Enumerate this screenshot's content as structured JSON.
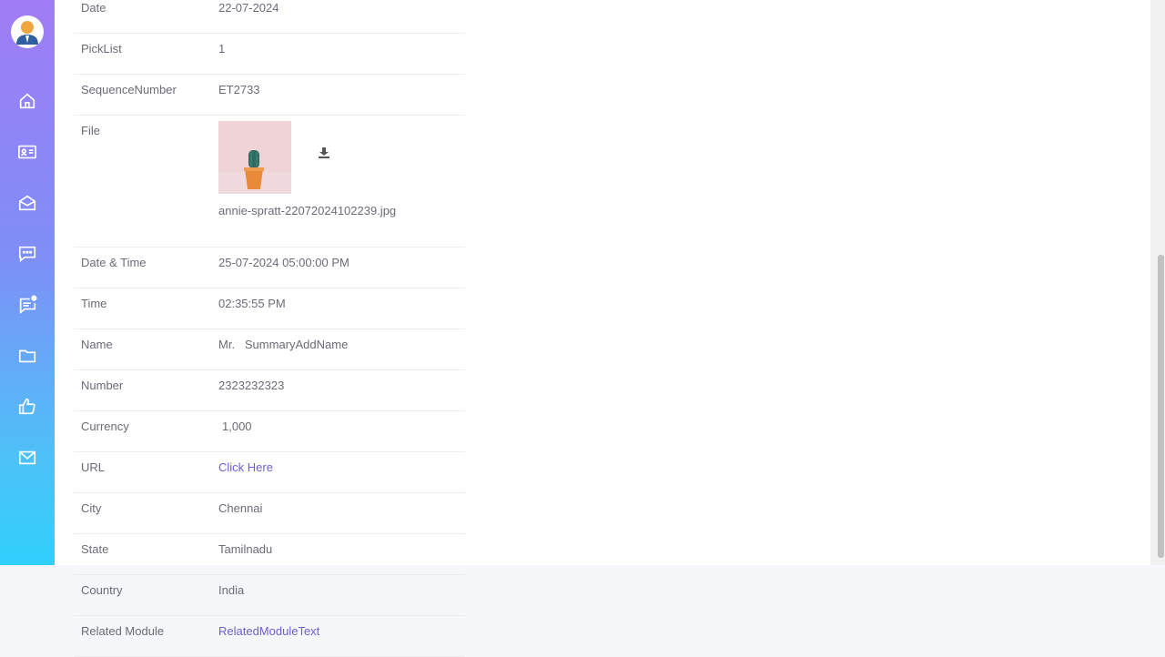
{
  "sidebar": {
    "items": [
      "home-icon",
      "contact-card-icon",
      "mail-open-icon",
      "chat-icon",
      "notification-message-icon",
      "folder-icon",
      "thumbs-up-icon",
      "mail-icon"
    ]
  },
  "record": {
    "rows": [
      {
        "label": "Date",
        "value": "22-07-2024"
      },
      {
        "label": "PickList",
        "value": "1"
      },
      {
        "label": "SequenceNumber",
        "value": "ET2733"
      },
      {
        "label": "File",
        "value": "annie-spratt-22072024102239.jpg"
      },
      {
        "label": "Date & Time",
        "value": "25-07-2024 05:00:00 PM"
      },
      {
        "label": "Time",
        "value": "02:35:55 PM"
      },
      {
        "label": "Name",
        "value": "Mr.   SummaryAddName"
      },
      {
        "label": "Number",
        "value": "2323232323"
      },
      {
        "label": "Currency",
        "value": "1,000"
      },
      {
        "label": "URL",
        "value": "Click Here"
      },
      {
        "label": "City",
        "value": "Chennai"
      },
      {
        "label": "State",
        "value": "Tamilnadu"
      },
      {
        "label": "Country",
        "value": "India"
      },
      {
        "label": "Related Module",
        "value": "RelatedModuleText"
      }
    ]
  },
  "colors": {
    "link": "#6a5fd0",
    "text": "#6b6b78",
    "sidebar_top": "#a07cf5",
    "sidebar_bottom": "#30d0fc"
  }
}
